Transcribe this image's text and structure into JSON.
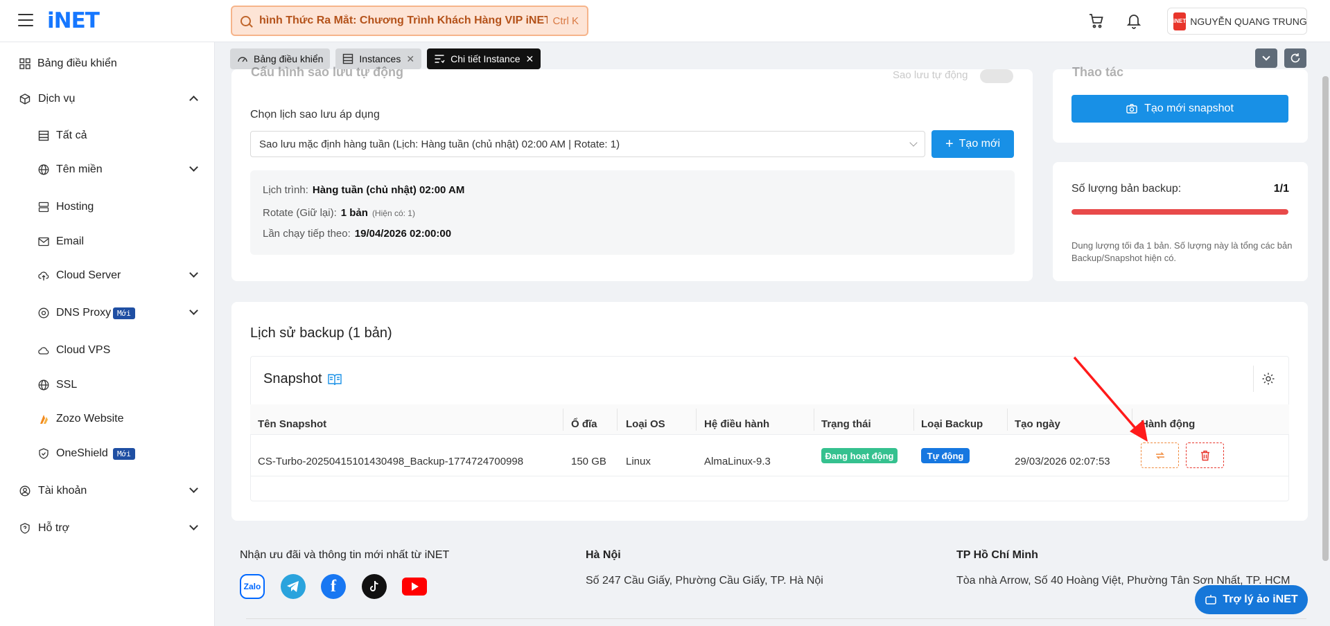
{
  "header": {
    "logo": "iNET",
    "search_text": "hình Thức Ra Mắt: Chương Trình Khách Hàng VIP iNET",
    "search_shortcut": "Ctrl K",
    "user_avatar": "iNET",
    "user_name": "NGUYỄN QUANG TRUNG"
  },
  "sidebar": {
    "dashboard": "Bảng điều khiển",
    "services": "Dịch vụ",
    "all": "Tất cả",
    "domain": "Tên miền",
    "hosting": "Hosting",
    "email": "Email",
    "cloud_server": "Cloud Server",
    "dns_proxy": "DNS Proxy",
    "cloud_vps": "Cloud VPS",
    "ssl": "SSL",
    "zozo": "Zozo Website",
    "oneshield": "OneShield",
    "account": "Tài khoản",
    "support": "Hỗ trợ",
    "new_badge": "Mới"
  },
  "tabs": [
    {
      "label": "Bảng điều khiển"
    },
    {
      "label": "Instances"
    },
    {
      "label": "Chi tiết Instance"
    }
  ],
  "backup_config": {
    "title": "Cấu hình sao lưu tự động",
    "auto_backup_label": "Sao lưu tự động",
    "schedule_label": "Chọn lịch sao lưu áp dụng",
    "schedule_value": "Sao lưu mặc định hàng tuần (Lịch: Hàng tuần (chủ nhật) 02:00 AM | Rotate: 1)",
    "create_button": "Tạo mới",
    "schedule_key": "Lịch trình:",
    "schedule_val": "Hàng tuần (chủ nhật) 02:00 AM",
    "rotate_key": "Rotate (Giữ lại):",
    "rotate_val": "1 bản",
    "rotate_note": "(Hiện có: 1)",
    "next_run_key": "Lần chạy tiếp theo:",
    "next_run_val": "19/04/2026 02:00:00"
  },
  "snapshot_panel": {
    "title": "Thao tác",
    "create_snapshot_button": "Tạo mới snapshot"
  },
  "quota": {
    "label": "Số lượng bản backup:",
    "value": "1/1",
    "fill_fraction": 1.0,
    "note": "Dung lượng tối đa 1 bản. Số lượng này là tổng các bản Backup/Snapshot hiện có."
  },
  "history": {
    "title": "Lịch sử backup (1 bản)",
    "section_title": "Snapshot",
    "columns": [
      "Tên Snapshot",
      "Ổ đĩa",
      "Loại OS",
      "Hệ điều hành",
      "Trạng thái",
      "Loại Backup",
      "Tạo ngày",
      "Hành động"
    ],
    "rows": [
      {
        "name": "CS-Turbo-20250415101430498_Backup-1774724700998",
        "disk": "150 GB",
        "os_type": "Linux",
        "os": "AlmaLinux-9.3",
        "status": "Đang hoạt động",
        "backup_type": "Tự động",
        "created": "29/03/2026 02:07:53"
      }
    ]
  },
  "footer": {
    "newsletter": "Nhận ưu đãi và thông tin mới nhất từ iNET",
    "hanoi_title": "Hà Nội",
    "hanoi_address": "Số 247 Cầu Giấy, Phường Cầu Giấy, TP. Hà Nội",
    "hcm_title": "TP Hồ Chí Minh",
    "hcm_address": "Tòa nhà Arrow, Số 40 Hoàng Việt, Phường Tân Sơn Nhất, TP. HCM",
    "zalo": "Zalo"
  },
  "assistant_button": "Trợ lý ảo iNET",
  "colors": {
    "primary": "#1890e6",
    "status_green": "#35c18f",
    "backup_blue": "#1677e0",
    "quota_red": "#e84a4a",
    "restore_orange": "#f08a3c",
    "delete_red": "#e8352b"
  }
}
